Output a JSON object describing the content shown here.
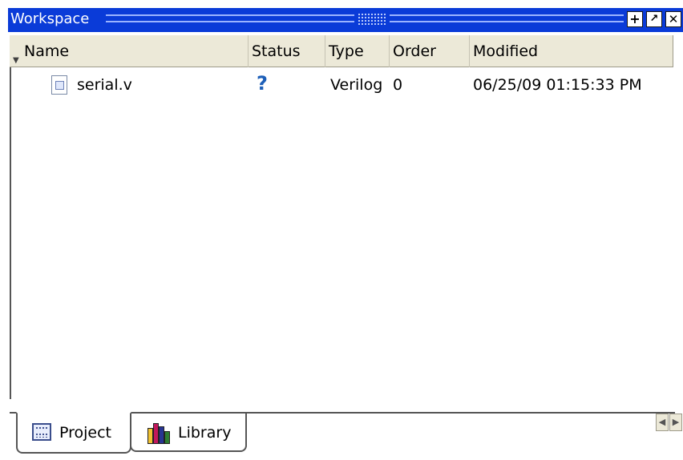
{
  "window": {
    "title": "Workspace"
  },
  "titlebar_icons": {
    "add": "plus-icon",
    "undock": "undock-icon",
    "close": "close-icon"
  },
  "columns": {
    "name": "Name",
    "status": "Status",
    "type": "Type",
    "order": "Order",
    "modified": "Modified"
  },
  "rows": [
    {
      "icon": "verilog-file-icon",
      "name": "serial.v",
      "status_icon": "question-mark-icon",
      "status_glyph": "?",
      "type": "Verilog",
      "order": "0",
      "modified": "06/25/09 01:15:33 PM"
    }
  ],
  "tabs": [
    {
      "label": "Project",
      "icon": "project-icon",
      "active": true
    },
    {
      "label": "Library",
      "icon": "library-icon",
      "active": false
    }
  ],
  "colors": {
    "titlebar": "#0a3bd8",
    "header_bg": "#ece9d8",
    "status_icon": "#1d5fb8"
  }
}
